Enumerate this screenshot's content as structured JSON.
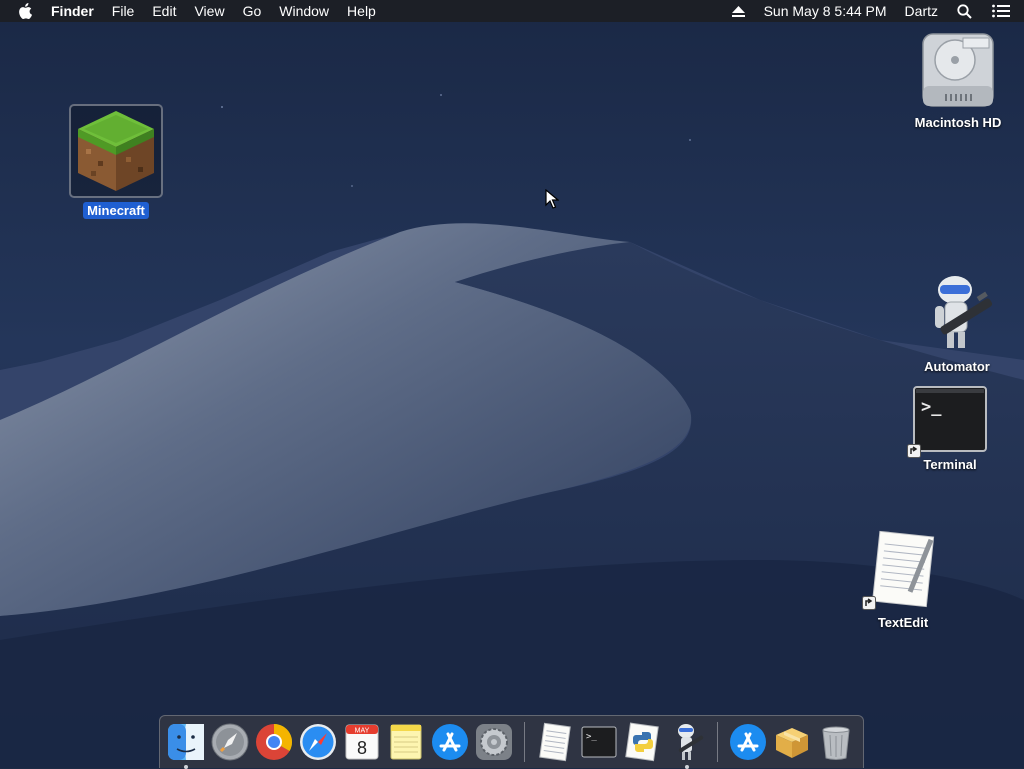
{
  "menubar": {
    "app_name": "Finder",
    "menus": [
      "File",
      "Edit",
      "View",
      "Go",
      "Window",
      "Help"
    ],
    "datetime": "Sun May 8  5:44 PM",
    "user": "Dartz",
    "icons": [
      "apple-icon",
      "eject-icon",
      "spotlight-search-icon",
      "notification-center-icon"
    ]
  },
  "desktop": {
    "icons": [
      {
        "label": "Minecraft",
        "icon": "minecraft-grass-block-icon",
        "selected": true
      },
      {
        "label": "Macintosh HD",
        "icon": "hard-drive-icon"
      },
      {
        "label": "Automator",
        "icon": "automator-robot-icon"
      },
      {
        "label": "Terminal",
        "icon": "terminal-icon",
        "alias": true
      },
      {
        "label": "TextEdit",
        "icon": "textedit-icon",
        "alias": true
      }
    ]
  },
  "dock": {
    "items": [
      {
        "name": "Finder",
        "icon": "finder-icon",
        "running": true
      },
      {
        "name": "Launchpad",
        "icon": "launchpad-icon"
      },
      {
        "name": "Google Chrome",
        "icon": "chrome-icon"
      },
      {
        "name": "Safari",
        "icon": "safari-icon"
      },
      {
        "name": "Calendar",
        "icon": "calendar-icon",
        "month": "MAY",
        "day": "8"
      },
      {
        "name": "Notes",
        "icon": "notes-icon"
      },
      {
        "name": "App Store",
        "icon": "app-store-icon"
      },
      {
        "name": "System Preferences",
        "icon": "system-preferences-icon"
      },
      {
        "name": "TextEdit",
        "icon": "textedit-icon"
      },
      {
        "name": "Terminal",
        "icon": "terminal-icon",
        "prompt": ">_"
      },
      {
        "name": "Python Launcher",
        "icon": "python-icon"
      },
      {
        "name": "Automator",
        "icon": "automator-robot-icon",
        "running": true
      },
      {
        "name": "App Store",
        "icon": "app-store-icon"
      },
      {
        "name": "Archive",
        "icon": "package-icon"
      },
      {
        "name": "Trash",
        "icon": "trash-icon"
      }
    ]
  },
  "colors": {
    "menubar_bg": "#1c1e24",
    "selection_blue": "#1f5fd1",
    "wallpaper_sky": "#1d2a44"
  }
}
